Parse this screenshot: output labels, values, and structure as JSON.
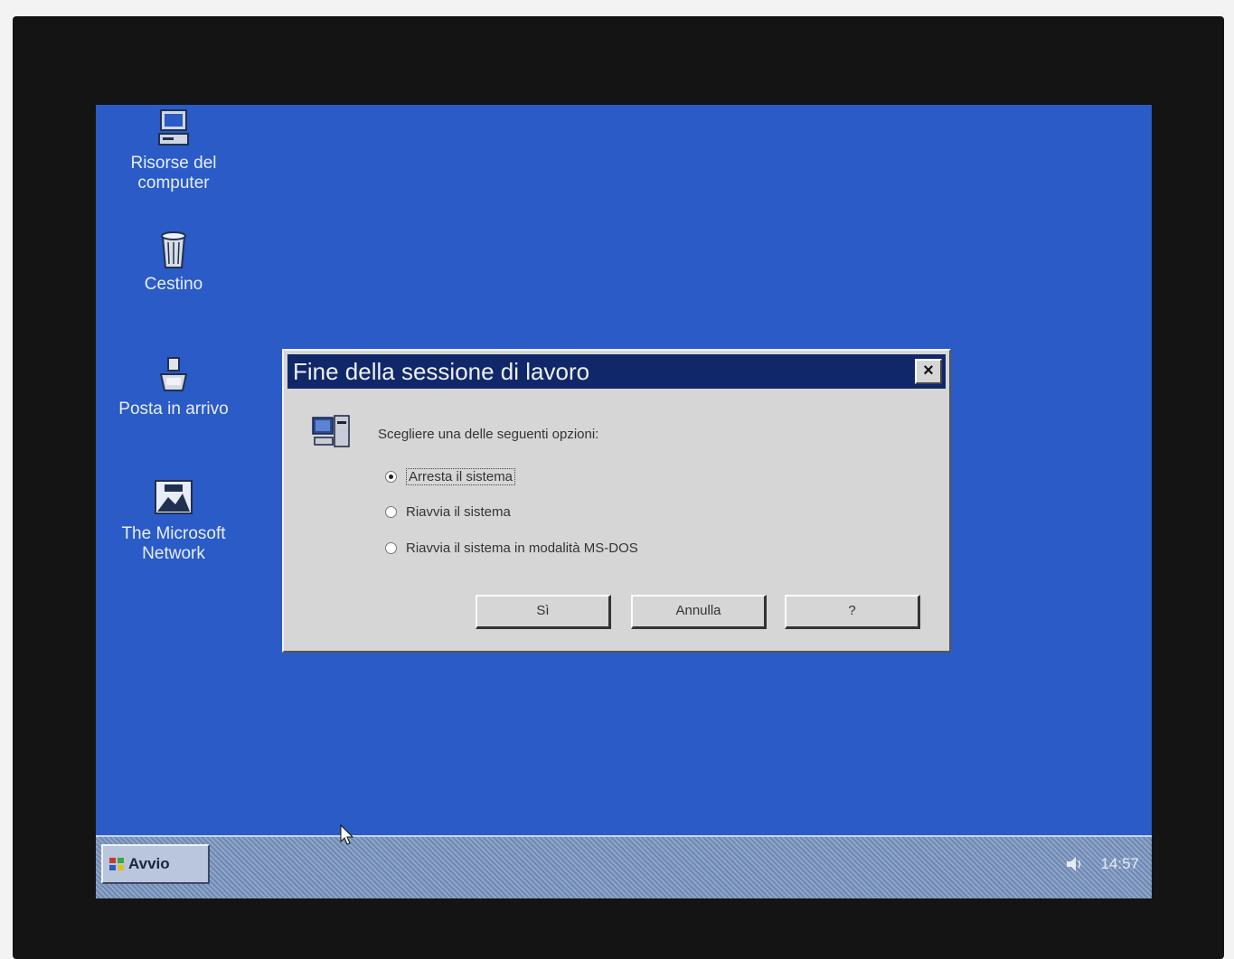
{
  "desktop": {
    "icons": [
      {
        "label_line1": "Risorse del",
        "label_line2": "computer",
        "icon": "computer-icon"
      },
      {
        "label_line1": "Cestino",
        "label_line2": "",
        "icon": "recycle-bin-icon"
      },
      {
        "label_line1": "Posta in arrivo",
        "label_line2": "",
        "icon": "inbox-icon"
      },
      {
        "label_line1": "The Microsoft",
        "label_line2": "Network",
        "icon": "msn-icon"
      }
    ]
  },
  "dialog": {
    "title": "Fine della sessione di lavoro",
    "close_label": "×",
    "prompt": "Scegliere una delle seguenti opzioni:",
    "options": [
      {
        "label": "Arresta il sistema",
        "checked": true
      },
      {
        "label": "Riavvia il sistema",
        "checked": false
      },
      {
        "label": "Riavvia il sistema in modalità MS-DOS",
        "checked": false
      }
    ],
    "buttons": {
      "ok": "Sì",
      "cancel": "Annulla",
      "help": "?"
    }
  },
  "taskbar": {
    "start_label": "Avvio",
    "clock": "14:57"
  },
  "colors": {
    "desktop": "#2a5bc6",
    "titlebar": "#10286a",
    "dialog_face": "#d6d6d6"
  }
}
